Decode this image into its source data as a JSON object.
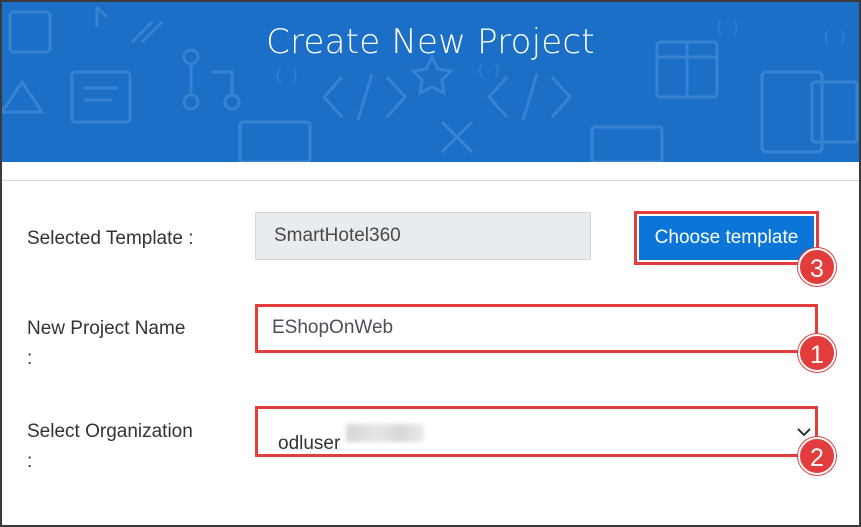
{
  "header": {
    "title": "Create New Project"
  },
  "form": {
    "template_label": "Selected Template :",
    "template_value": "SmartHotel360",
    "choose_button": "Choose template",
    "project_label": "New Project Name",
    "project_label_colon": ":",
    "project_value": "EShopOnWeb",
    "org_label": "Select Organization",
    "org_label_colon": ":",
    "org_value": "odluser"
  },
  "annotations": {
    "badge_1": "1",
    "badge_2": "2",
    "badge_3": "3"
  },
  "colors": {
    "banner": "#1b6fc7",
    "primary_button": "#0b76d8",
    "highlight": "#e23c3c"
  },
  "icons": [
    "chevron-down-icon"
  ]
}
